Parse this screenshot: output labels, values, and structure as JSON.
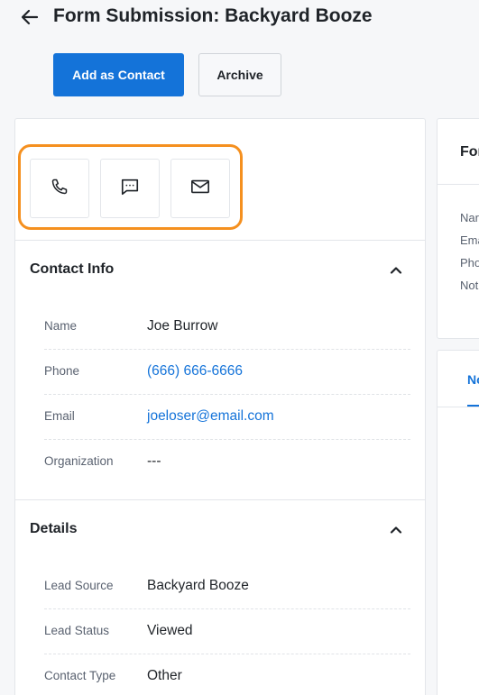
{
  "header": {
    "title": "Form Submission: Backyard Booze"
  },
  "actions": {
    "add_contact_label": "Add as Contact",
    "archive_label": "Archive"
  },
  "quick_actions": {
    "icons": [
      "phone-icon",
      "message-icon",
      "mail-icon"
    ]
  },
  "contact_info": {
    "title": "Contact Info",
    "rows": [
      {
        "label": "Name",
        "value": "Joe Burrow"
      },
      {
        "label": "Phone",
        "value": "(666) 666-6666"
      },
      {
        "label": "Email",
        "value": "joeloser@email.com"
      },
      {
        "label": "Organization",
        "value": "---"
      }
    ]
  },
  "details": {
    "title": "Details",
    "rows": [
      {
        "label": "Lead Source",
        "value": "Backyard Booze"
      },
      {
        "label": "Lead Status",
        "value": "Viewed"
      },
      {
        "label": "Contact Type",
        "value": "Other"
      }
    ]
  },
  "right_panel": {
    "title_partial": "For",
    "labels_partial": [
      "Nar",
      "Ema",
      "Pho",
      "Not"
    ],
    "tab_partial": "No"
  },
  "colors": {
    "primary": "#1473d9",
    "highlight": "#f5901f",
    "link": "#1473d9"
  }
}
